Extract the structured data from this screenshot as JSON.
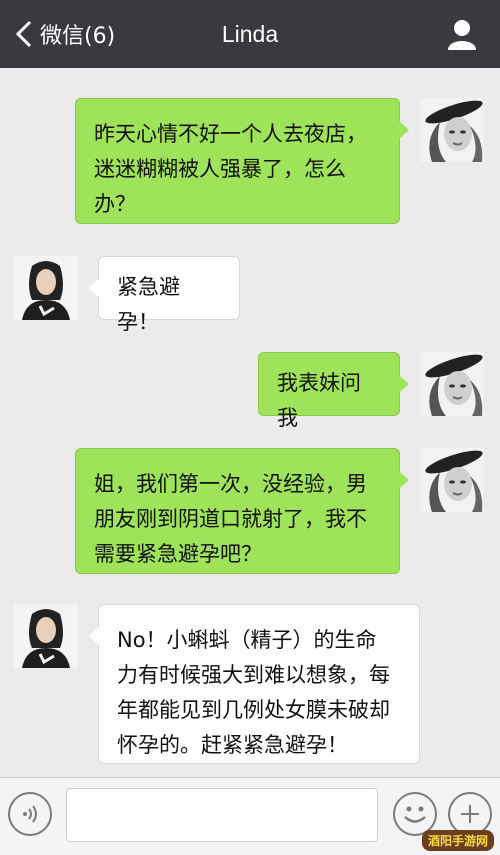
{
  "header": {
    "back_label": "微信(6)",
    "title": "Linda"
  },
  "messages": [
    {
      "side": "right",
      "lines": [
        "昨天心情不好一个人去夜店，",
        "迷迷糊糊被人强暴了，怎么",
        "办？"
      ]
    },
    {
      "side": "left",
      "lines": [
        "紧急避孕！"
      ]
    },
    {
      "side": "right",
      "lines": [
        "我表妹问我"
      ]
    },
    {
      "side": "right",
      "lines": [
        "姐，我们第一次，没经验，男",
        "朋友刚到阴道口就射了，我不",
        "需要紧急避孕吧？"
      ]
    },
    {
      "side": "left",
      "lines": [
        "No！小蝌蚪（精子）的生命",
        "力有时候强大到难以想象，每",
        "年都能见到几例处女膜未破却",
        "怀孕的。赶紧紧急避孕！"
      ]
    }
  ],
  "footer": {
    "input_value": "",
    "watermark": "酒阳手游网"
  },
  "colors": {
    "header_bg": "#393a3f",
    "chat_bg": "#ebebeb",
    "sent_bubble": "#9fe35a",
    "received_bubble": "#ffffff"
  },
  "icons": [
    "chevron-left-icon",
    "user-profile-icon",
    "voice-icon",
    "emoji-icon",
    "plus-icon"
  ]
}
